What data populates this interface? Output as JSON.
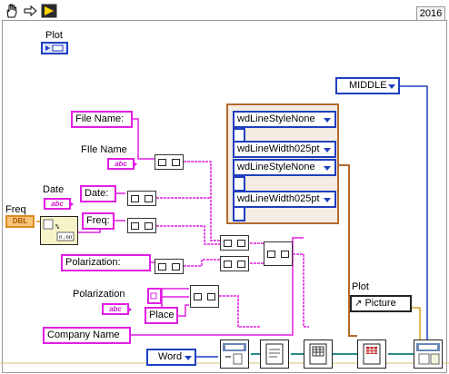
{
  "toolbar": {
    "icons": [
      "hand-icon",
      "arrow-icon",
      "run-icon"
    ],
    "version": "2016"
  },
  "labels": {
    "plot_top": "Plot",
    "file_name": "FIle Name",
    "date": "Date",
    "freq": "Freq",
    "polarization": "Polarization",
    "plot_picture": "Plot"
  },
  "constants": {
    "file_name": "File Name:",
    "date": "Date:",
    "freq": "Freq:",
    "polarization": "Polarization:",
    "company_name": "Company Name",
    "place": "Place"
  },
  "controls": {
    "abc": "abc",
    "dbl": "DBL",
    "middle": "MIDDLE",
    "word": "Word",
    "picture": "Picture"
  },
  "cluster": {
    "items": [
      "wdLineStyleNone",
      "wdLineWidth025pt",
      "wdLineStyleNone",
      "wdLineWidth025pt"
    ]
  },
  "colors": {
    "string_wire": "#e21ee2",
    "enum_wire": "#1f3fbf",
    "numeric_wire": "#e08a1e",
    "cluster_wire": "#b36a2e",
    "refnum_wire": "#2a8a8a"
  }
}
